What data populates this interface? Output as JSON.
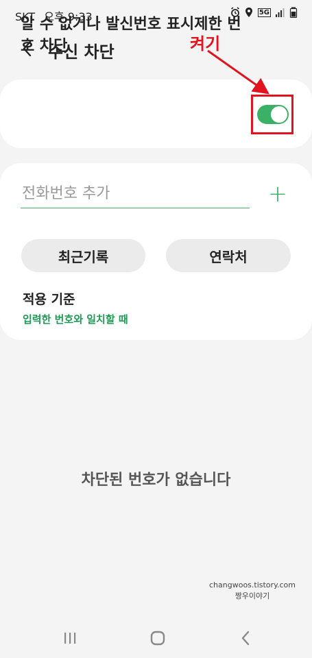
{
  "status_bar": {
    "carrier": "SKT",
    "time": "오후 9:33",
    "network_label": "5G"
  },
  "header": {
    "title": "수신 차단"
  },
  "annotation": {
    "label": "켜기",
    "color": "#e1131e"
  },
  "toggle_card": {
    "label": "알 수 없거나 발신번호 표시제한 번호 차단",
    "enabled": true,
    "accent_color": "#3bb168"
  },
  "add_number": {
    "placeholder": "전화번호 추가",
    "value": ""
  },
  "buttons": {
    "recent": "최근기록",
    "contacts": "연락처"
  },
  "criteria": {
    "title": "적용 기준",
    "value": "입력한 번호와 일치할 때"
  },
  "empty_state": {
    "message": "차단된 번호가 없습니다"
  },
  "watermark": {
    "line1": "changwoos.tistory.com",
    "line2": "짱우이야기"
  }
}
